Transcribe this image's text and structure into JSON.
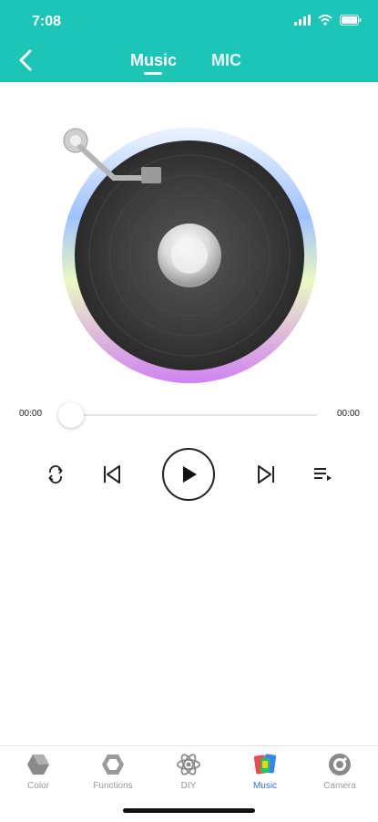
{
  "status_bar": {
    "time": "7:08"
  },
  "header": {
    "tabs": [
      {
        "label": "Music",
        "active": true
      },
      {
        "label": "MIC",
        "active": false
      }
    ]
  },
  "player": {
    "current_time": "00:00",
    "total_time": "00:00",
    "progress": 0
  },
  "bottom_nav": {
    "items": [
      {
        "label": "Color",
        "icon": "hexagon-icon"
      },
      {
        "label": "Functions",
        "icon": "hexagon-outline-icon"
      },
      {
        "label": "DIY",
        "icon": "atom-icon"
      },
      {
        "label": "Music",
        "icon": "music-colorful-icon",
        "active": true
      },
      {
        "label": "Camera",
        "icon": "camera-icon"
      }
    ]
  },
  "colors": {
    "accent": "#1cc5b5",
    "active_nav": "#2f6cf5"
  }
}
